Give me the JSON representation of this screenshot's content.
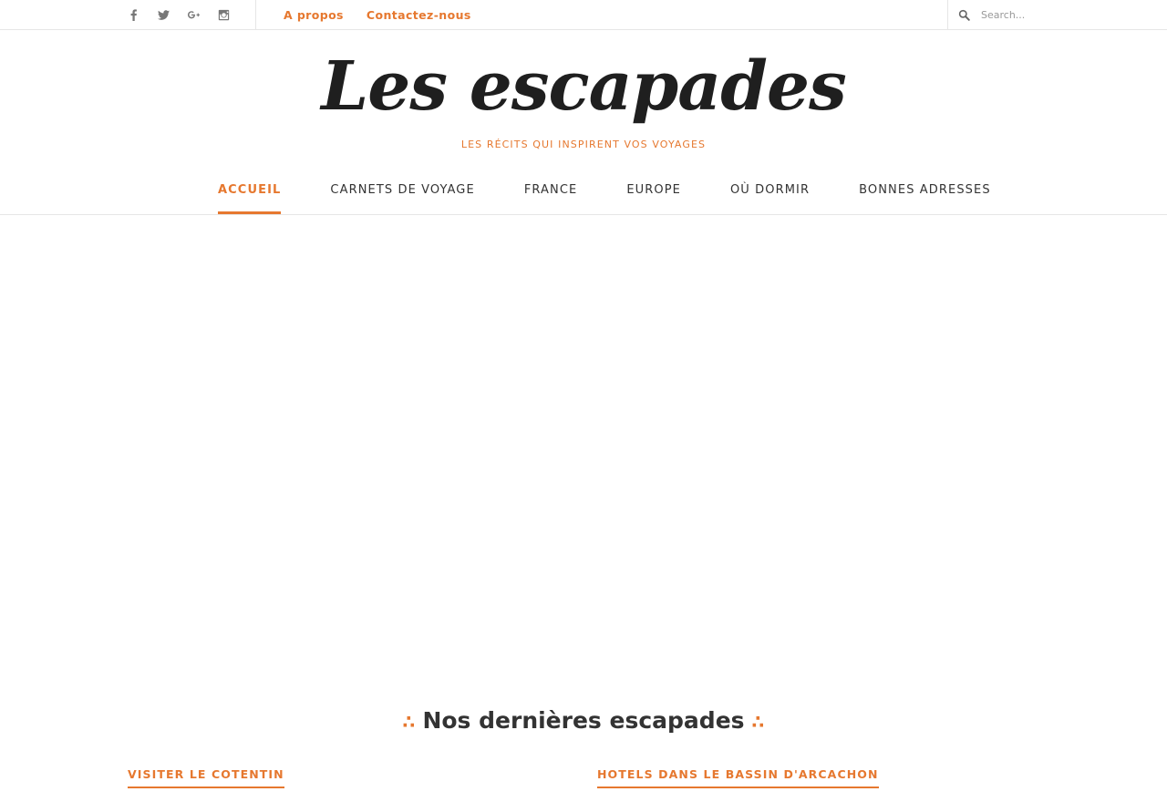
{
  "topbar": {
    "social_icons": [
      "facebook-icon",
      "twitter-icon",
      "google-plus-icon",
      "instagram-icon"
    ],
    "links": [
      "A propos",
      "Contactez-nous"
    ],
    "search": {
      "placeholder": "Search...",
      "value": ""
    }
  },
  "branding": {
    "title": "Les escapades",
    "tagline": "LES RÉCITS QUI INSPIRENT VOS VOYAGES"
  },
  "nav": {
    "items": [
      "ACCUEIL",
      "CARNETS DE VOYAGE",
      "FRANCE",
      "EUROPE",
      "OÙ DORMIR",
      "BONNES ADRESSES"
    ],
    "active": "ACCUEIL"
  },
  "section": {
    "heading": "Nos dernières escapades",
    "ornament": "∴"
  },
  "posts": [
    {
      "title": "VISITER LE COTENTIN"
    },
    {
      "title": "HOTELS DANS LE BASSIN D'ARCACHON"
    }
  ],
  "colors": {
    "accent": "#e6782f",
    "text": "#333333",
    "border": "#e6e6e6"
  }
}
